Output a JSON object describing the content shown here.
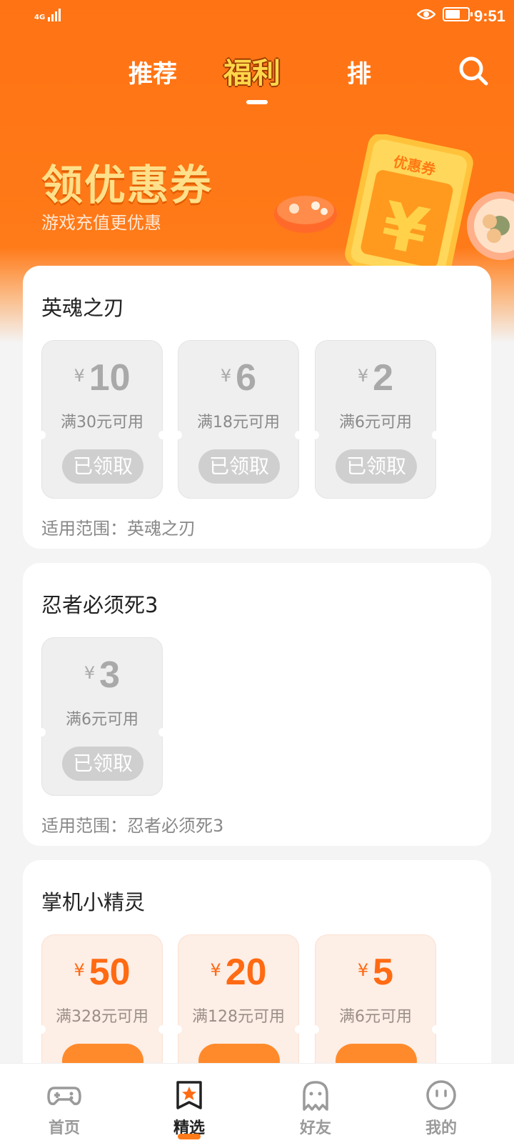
{
  "status": {
    "network": "4G",
    "time": "9:51",
    "battery_level": 0.7
  },
  "header": {
    "tabs": [
      {
        "label": "推荐",
        "active": false
      },
      {
        "label": "福利",
        "active": true
      },
      {
        "label": "排",
        "active": false
      }
    ],
    "search_icon": "search-icon"
  },
  "banner": {
    "title": "领优惠券",
    "subtitle": "游戏充值更优惠",
    "ticket_label": "优惠券",
    "ticket_symbol": "¥"
  },
  "games": [
    {
      "name": "英魂之刃",
      "scope": "适用范围：英魂之刃",
      "coupons": [
        {
          "currency": "¥",
          "value": "10",
          "condition": "满30元可用",
          "button": "已领取",
          "claimed": true
        },
        {
          "currency": "¥",
          "value": "6",
          "condition": "满18元可用",
          "button": "已领取",
          "claimed": true
        },
        {
          "currency": "¥",
          "value": "2",
          "condition": "满6元可用",
          "button": "已领取",
          "claimed": true
        }
      ]
    },
    {
      "name": "忍者必须死3",
      "scope": "适用范围：忍者必须死3",
      "coupons": [
        {
          "currency": "¥",
          "value": "3",
          "condition": "满6元可用",
          "button": "已领取",
          "claimed": true
        }
      ]
    },
    {
      "name": "掌机小精灵",
      "coupons": [
        {
          "currency": "¥",
          "value": "50",
          "condition": "满328元可用",
          "claimed": false
        },
        {
          "currency": "¥",
          "value": "20",
          "condition": "满128元可用",
          "claimed": false
        },
        {
          "currency": "¥",
          "value": "5",
          "condition": "满6元可用",
          "claimed": false
        }
      ]
    }
  ],
  "bottom_nav": [
    {
      "label": "首页",
      "icon": "gamepad-icon",
      "active": false
    },
    {
      "label": "精选",
      "icon": "star-bookmark-icon",
      "active": true
    },
    {
      "label": "好友",
      "icon": "ghost-icon",
      "active": false
    },
    {
      "label": "我的",
      "icon": "smiley-face-icon",
      "active": false
    }
  ],
  "colors": {
    "brand_orange": "#ff7314",
    "title_yellow": "#ffd64a",
    "claimed_gray": "#cfcfcf",
    "coupon_active_bg": "#fdeee6",
    "coupon_active_text": "#ff6a12"
  }
}
